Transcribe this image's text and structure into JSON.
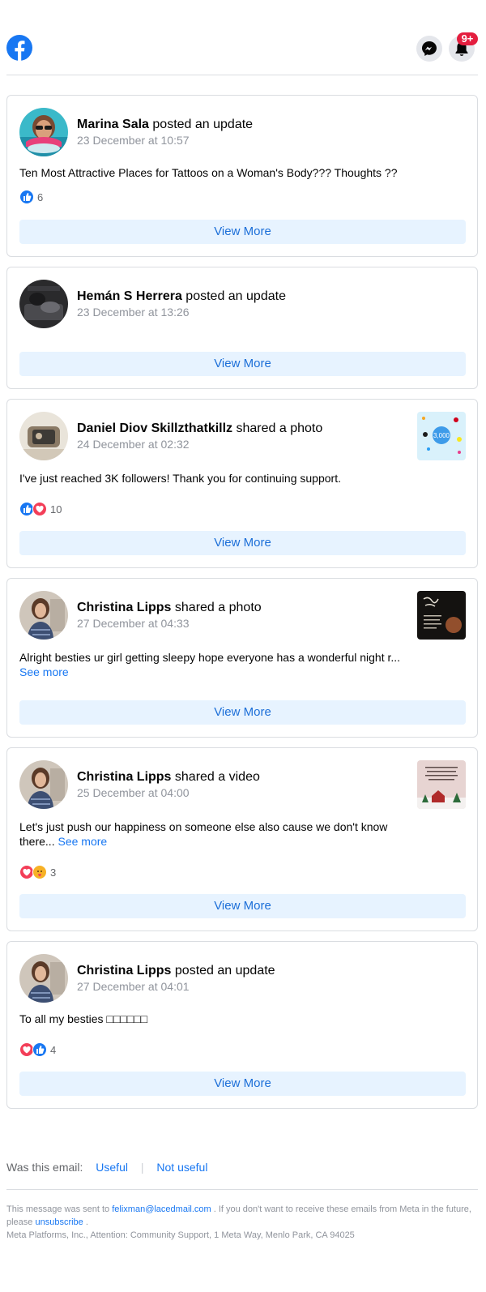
{
  "header": {
    "logo_icon": "facebook-logo-icon",
    "messenger_icon": "messenger-icon",
    "notifications_icon": "bell-icon",
    "notifications_badge": "9+"
  },
  "posts": [
    {
      "author": "Marina Sala",
      "action": "posted an update",
      "date": "23 December at 10:57",
      "text": "Ten Most Attractive Places for Tattoos on a Woman's Body??? Thoughts ??",
      "reactions": [
        "like"
      ],
      "reaction_count": "6",
      "button": "View More"
    },
    {
      "author": "Hemán S Herrera",
      "action": "posted an update",
      "date": "23 December at 13:26",
      "button": "View More"
    },
    {
      "author": "Daniel Diov Skillzthatkillz",
      "action": "shared a photo",
      "date": "24 December at 02:32",
      "text": "I've just reached 3K followers! Thank you for continuing support.",
      "reactions": [
        "like",
        "love"
      ],
      "reaction_count": "10",
      "button": "View More",
      "thumb_text": "3,000"
    },
    {
      "author": "Christina Lipps",
      "action": "shared a photo",
      "date": "27 December at 04:33",
      "text": "Alright besties ur girl getting sleepy hope everyone has a wonderful night r...",
      "see_more": "See more",
      "button": "View More"
    },
    {
      "author": "Christina Lipps",
      "action": "shared a video",
      "date": "25 December at 04:00",
      "text": "Let's just push our happiness on someone else also cause we don't know there...",
      "see_more": "See more",
      "reactions": [
        "love",
        "care"
      ],
      "reaction_count": "3",
      "button": "View More"
    },
    {
      "author": "Christina Lipps",
      "action": "posted an update",
      "date": "27 December at 04:01",
      "text": "To all my besties □□□□□□",
      "reactions": [
        "love",
        "like"
      ],
      "reaction_count": "4",
      "button": "View More"
    }
  ],
  "feedback": {
    "question": "Was this email:",
    "useful": "Useful",
    "separator": "|",
    "not_useful": "Not useful"
  },
  "footer": {
    "sent_to_prefix": "This message was sent to",
    "email": "felixman@lacedmail.com",
    "sent_to_suffix": ". If you don't want to receive these emails from Meta in the future, please",
    "unsubscribe": "unsubscribe",
    "period": ".",
    "address": "Meta Platforms, Inc., Attention: Community Support, 1 Meta Way, Menlo Park, CA 94025"
  },
  "colors": {
    "facebook_blue": "#1877f2",
    "badge_red": "#e41e3f",
    "button_bg": "#e7f3ff",
    "love_red": "#f33e58",
    "care_yellow": "#f7b125"
  }
}
